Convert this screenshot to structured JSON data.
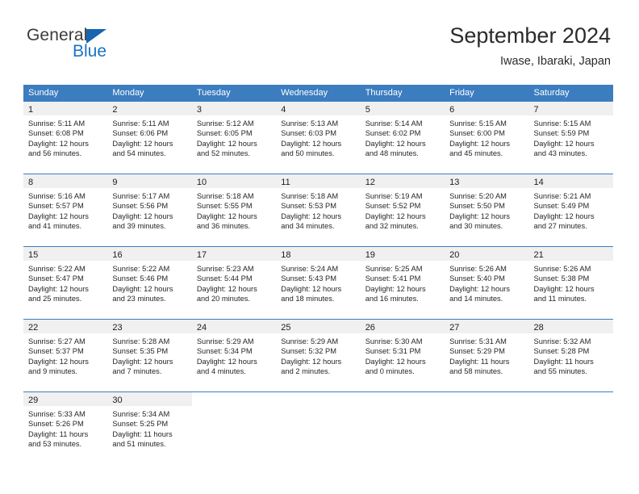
{
  "brand": {
    "name_top": "General",
    "name_bottom": "Blue",
    "accent_color": "#1565b0",
    "triangle_icon": "triangle-icon"
  },
  "header": {
    "title": "September 2024",
    "subtitle": "Iwase, Ibaraki, Japan"
  },
  "theme": {
    "header_row_bg": "#3b7dbf",
    "day_band_bg": "#f0f0f0",
    "text_color": "#262626"
  },
  "weekdays": [
    "Sunday",
    "Monday",
    "Tuesday",
    "Wednesday",
    "Thursday",
    "Friday",
    "Saturday"
  ],
  "weeks": [
    [
      {
        "day": "1",
        "sunrise": "Sunrise: 5:11 AM",
        "sunset": "Sunset: 6:08 PM",
        "daylight1": "Daylight: 12 hours",
        "daylight2": "and 56 minutes."
      },
      {
        "day": "2",
        "sunrise": "Sunrise: 5:11 AM",
        "sunset": "Sunset: 6:06 PM",
        "daylight1": "Daylight: 12 hours",
        "daylight2": "and 54 minutes."
      },
      {
        "day": "3",
        "sunrise": "Sunrise: 5:12 AM",
        "sunset": "Sunset: 6:05 PM",
        "daylight1": "Daylight: 12 hours",
        "daylight2": "and 52 minutes."
      },
      {
        "day": "4",
        "sunrise": "Sunrise: 5:13 AM",
        "sunset": "Sunset: 6:03 PM",
        "daylight1": "Daylight: 12 hours",
        "daylight2": "and 50 minutes."
      },
      {
        "day": "5",
        "sunrise": "Sunrise: 5:14 AM",
        "sunset": "Sunset: 6:02 PM",
        "daylight1": "Daylight: 12 hours",
        "daylight2": "and 48 minutes."
      },
      {
        "day": "6",
        "sunrise": "Sunrise: 5:15 AM",
        "sunset": "Sunset: 6:00 PM",
        "daylight1": "Daylight: 12 hours",
        "daylight2": "and 45 minutes."
      },
      {
        "day": "7",
        "sunrise": "Sunrise: 5:15 AM",
        "sunset": "Sunset: 5:59 PM",
        "daylight1": "Daylight: 12 hours",
        "daylight2": "and 43 minutes."
      }
    ],
    [
      {
        "day": "8",
        "sunrise": "Sunrise: 5:16 AM",
        "sunset": "Sunset: 5:57 PM",
        "daylight1": "Daylight: 12 hours",
        "daylight2": "and 41 minutes."
      },
      {
        "day": "9",
        "sunrise": "Sunrise: 5:17 AM",
        "sunset": "Sunset: 5:56 PM",
        "daylight1": "Daylight: 12 hours",
        "daylight2": "and 39 minutes."
      },
      {
        "day": "10",
        "sunrise": "Sunrise: 5:18 AM",
        "sunset": "Sunset: 5:55 PM",
        "daylight1": "Daylight: 12 hours",
        "daylight2": "and 36 minutes."
      },
      {
        "day": "11",
        "sunrise": "Sunrise: 5:18 AM",
        "sunset": "Sunset: 5:53 PM",
        "daylight1": "Daylight: 12 hours",
        "daylight2": "and 34 minutes."
      },
      {
        "day": "12",
        "sunrise": "Sunrise: 5:19 AM",
        "sunset": "Sunset: 5:52 PM",
        "daylight1": "Daylight: 12 hours",
        "daylight2": "and 32 minutes."
      },
      {
        "day": "13",
        "sunrise": "Sunrise: 5:20 AM",
        "sunset": "Sunset: 5:50 PM",
        "daylight1": "Daylight: 12 hours",
        "daylight2": "and 30 minutes."
      },
      {
        "day": "14",
        "sunrise": "Sunrise: 5:21 AM",
        "sunset": "Sunset: 5:49 PM",
        "daylight1": "Daylight: 12 hours",
        "daylight2": "and 27 minutes."
      }
    ],
    [
      {
        "day": "15",
        "sunrise": "Sunrise: 5:22 AM",
        "sunset": "Sunset: 5:47 PM",
        "daylight1": "Daylight: 12 hours",
        "daylight2": "and 25 minutes."
      },
      {
        "day": "16",
        "sunrise": "Sunrise: 5:22 AM",
        "sunset": "Sunset: 5:46 PM",
        "daylight1": "Daylight: 12 hours",
        "daylight2": "and 23 minutes."
      },
      {
        "day": "17",
        "sunrise": "Sunrise: 5:23 AM",
        "sunset": "Sunset: 5:44 PM",
        "daylight1": "Daylight: 12 hours",
        "daylight2": "and 20 minutes."
      },
      {
        "day": "18",
        "sunrise": "Sunrise: 5:24 AM",
        "sunset": "Sunset: 5:43 PM",
        "daylight1": "Daylight: 12 hours",
        "daylight2": "and 18 minutes."
      },
      {
        "day": "19",
        "sunrise": "Sunrise: 5:25 AM",
        "sunset": "Sunset: 5:41 PM",
        "daylight1": "Daylight: 12 hours",
        "daylight2": "and 16 minutes."
      },
      {
        "day": "20",
        "sunrise": "Sunrise: 5:26 AM",
        "sunset": "Sunset: 5:40 PM",
        "daylight1": "Daylight: 12 hours",
        "daylight2": "and 14 minutes."
      },
      {
        "day": "21",
        "sunrise": "Sunrise: 5:26 AM",
        "sunset": "Sunset: 5:38 PM",
        "daylight1": "Daylight: 12 hours",
        "daylight2": "and 11 minutes."
      }
    ],
    [
      {
        "day": "22",
        "sunrise": "Sunrise: 5:27 AM",
        "sunset": "Sunset: 5:37 PM",
        "daylight1": "Daylight: 12 hours",
        "daylight2": "and 9 minutes."
      },
      {
        "day": "23",
        "sunrise": "Sunrise: 5:28 AM",
        "sunset": "Sunset: 5:35 PM",
        "daylight1": "Daylight: 12 hours",
        "daylight2": "and 7 minutes."
      },
      {
        "day": "24",
        "sunrise": "Sunrise: 5:29 AM",
        "sunset": "Sunset: 5:34 PM",
        "daylight1": "Daylight: 12 hours",
        "daylight2": "and 4 minutes."
      },
      {
        "day": "25",
        "sunrise": "Sunrise: 5:29 AM",
        "sunset": "Sunset: 5:32 PM",
        "daylight1": "Daylight: 12 hours",
        "daylight2": "and 2 minutes."
      },
      {
        "day": "26",
        "sunrise": "Sunrise: 5:30 AM",
        "sunset": "Sunset: 5:31 PM",
        "daylight1": "Daylight: 12 hours",
        "daylight2": "and 0 minutes."
      },
      {
        "day": "27",
        "sunrise": "Sunrise: 5:31 AM",
        "sunset": "Sunset: 5:29 PM",
        "daylight1": "Daylight: 11 hours",
        "daylight2": "and 58 minutes."
      },
      {
        "day": "28",
        "sunrise": "Sunrise: 5:32 AM",
        "sunset": "Sunset: 5:28 PM",
        "daylight1": "Daylight: 11 hours",
        "daylight2": "and 55 minutes."
      }
    ],
    [
      {
        "day": "29",
        "sunrise": "Sunrise: 5:33 AM",
        "sunset": "Sunset: 5:26 PM",
        "daylight1": "Daylight: 11 hours",
        "daylight2": "and 53 minutes."
      },
      {
        "day": "30",
        "sunrise": "Sunrise: 5:34 AM",
        "sunset": "Sunset: 5:25 PM",
        "daylight1": "Daylight: 11 hours",
        "daylight2": "and 51 minutes."
      },
      {
        "day": "",
        "sunrise": "",
        "sunset": "",
        "daylight1": "",
        "daylight2": ""
      },
      {
        "day": "",
        "sunrise": "",
        "sunset": "",
        "daylight1": "",
        "daylight2": ""
      },
      {
        "day": "",
        "sunrise": "",
        "sunset": "",
        "daylight1": "",
        "daylight2": ""
      },
      {
        "day": "",
        "sunrise": "",
        "sunset": "",
        "daylight1": "",
        "daylight2": ""
      },
      {
        "day": "",
        "sunrise": "",
        "sunset": "",
        "daylight1": "",
        "daylight2": ""
      }
    ]
  ]
}
